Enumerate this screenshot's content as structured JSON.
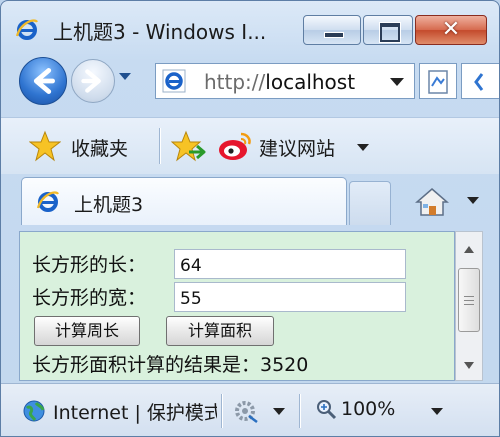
{
  "window": {
    "title": "上机题3 - Windows I...",
    "minimize_icon": "minimize-icon",
    "maximize_icon": "maximize-icon",
    "close_glyph": "✕"
  },
  "navigation": {
    "address_protocol": "http://",
    "address_host": "localhost"
  },
  "favorites_bar": {
    "favorites_label": "收藏夹",
    "suggested_sites_label": "建议网站"
  },
  "tabs": [
    {
      "label": "上机题3",
      "active": true
    }
  ],
  "page": {
    "length_label": "长方形的长：",
    "length_value": "64",
    "width_label": "长方形的宽：",
    "width_value": "55",
    "perimeter_button": "计算周长",
    "area_button": "计算面积",
    "result_text": "长方形面积计算的结果是：3520"
  },
  "status_bar": {
    "zone_text": "Internet | 保护模式",
    "zoom": "100%"
  },
  "colors": {
    "content_background": "#d9f1dd",
    "ie_blue": "#1a62c9",
    "star_yellow": "#f7c325",
    "weibo_red": "#e6162d"
  }
}
